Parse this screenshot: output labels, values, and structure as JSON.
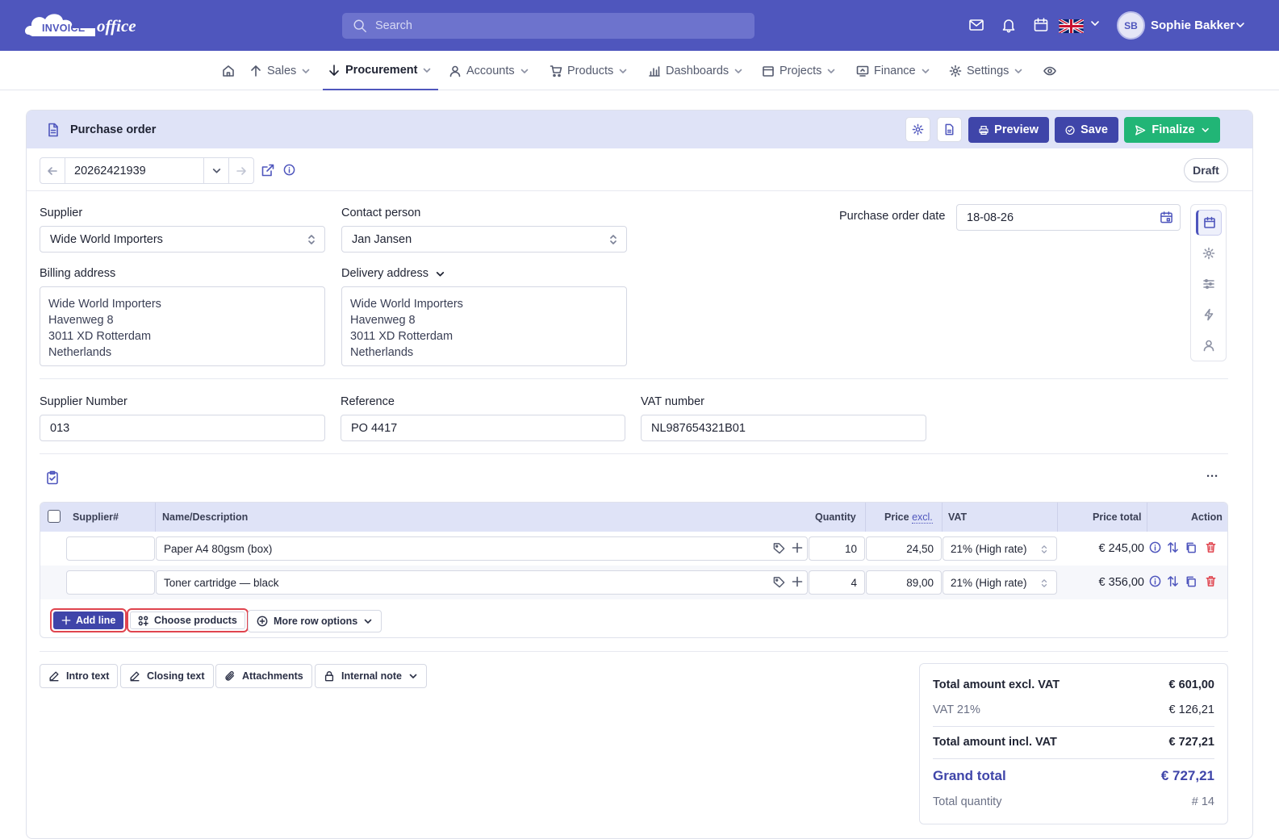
{
  "topbar": {
    "logo_word1": "INVOICE",
    "logo_word2": "office",
    "search_placeholder": "Search",
    "user_initials": "SB",
    "user_name": "Sophie Bakker"
  },
  "nav": [
    {
      "label": "Sales"
    },
    {
      "label": "Procurement"
    },
    {
      "label": "Accounts"
    },
    {
      "label": "Products"
    },
    {
      "label": "Dashboards"
    },
    {
      "label": "Projects"
    },
    {
      "label": "Finance"
    },
    {
      "label": "Settings"
    }
  ],
  "header": {
    "title": "Purchase order",
    "preview": "Preview",
    "save": "Save",
    "finalize": "Finalize"
  },
  "doc": {
    "number": "20262421939",
    "status": "Draft"
  },
  "form": {
    "supplier_label": "Supplier",
    "supplier_value": "Wide World Importers",
    "contact_label": "Contact person",
    "contact_value": "Jan Jansen",
    "date_label": "Purchase order date",
    "date_value": "18-08-26",
    "billing_label": "Billing address",
    "billing_lines": [
      "Wide World Importers",
      "Havenweg 8",
      "3011 XD Rotterdam",
      "Netherlands"
    ],
    "delivery_label": "Delivery address",
    "delivery_lines": [
      "Wide World Importers",
      "Havenweg 8",
      "3011 XD Rotterdam",
      "Netherlands"
    ],
    "supplier_number_label": "Supplier Number",
    "supplier_number_value": "013",
    "reference_label": "Reference",
    "reference_value": "PO 4417",
    "vat_label": "VAT number",
    "vat_value": "NL987654321B01"
  },
  "table": {
    "columns": {
      "supplier_no": "Supplier#",
      "name": "Name/Description",
      "quantity": "Quantity",
      "price": "Price",
      "price_excl": "excl.",
      "vat": "VAT",
      "price_total": "Price total",
      "action": "Action"
    },
    "rows": [
      {
        "supplier_no": "",
        "name": "Paper A4 80gsm (box)",
        "quantity": "10",
        "price": "24,50",
        "vat": "21% (High rate)",
        "total": "€ 245,00"
      },
      {
        "supplier_no": "",
        "name": "Toner cartridge — black",
        "quantity": "4",
        "price": "89,00",
        "vat": "21% (High rate)",
        "total": "€ 356,00"
      }
    ],
    "add_line": "Add line",
    "choose_products": "Choose products",
    "more_options": "More row options",
    "more_menu": "···"
  },
  "extras": {
    "intro": "Intro text",
    "closing": "Closing text",
    "attachments": "Attachments",
    "internal_note": "Internal note"
  },
  "totals": {
    "excl_label": "Total amount excl. VAT",
    "excl_value": "€ 601,00",
    "vat_label": "VAT 21%",
    "vat_value": "€ 126,21",
    "incl_label": "Total amount incl. VAT",
    "incl_value": "€ 727,21",
    "grand_label": "Grand total",
    "grand_value": "€ 727,21",
    "qty_label": "Total quantity",
    "qty_value": "# 14"
  },
  "colors": {
    "brand": "#4f56bd",
    "primary_button": "#3f45a9",
    "finalize": "#21b576",
    "highlight": "#e0444e"
  }
}
